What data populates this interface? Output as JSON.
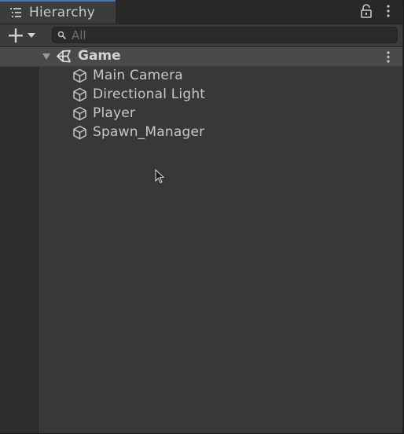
{
  "panel": {
    "title": "Hierarchy",
    "tab_icon": "list-icon",
    "lock_icon": "lock-icon",
    "menu_icon": "kebab-menu-icon"
  },
  "toolbar": {
    "add_icon": "plus-icon",
    "dropdown_icon": "dropdown-arrow-icon",
    "search": {
      "icon": "search-icon",
      "placeholder": "All",
      "value": ""
    }
  },
  "scene": {
    "name": "Game",
    "icon": "unity-scene-icon",
    "expanded": true
  },
  "objects": [
    {
      "label": "Main Camera",
      "icon": "gameobject-cube-icon"
    },
    {
      "label": "Directional Light",
      "icon": "gameobject-cube-icon"
    },
    {
      "label": "Player",
      "icon": "gameobject-cube-icon"
    },
    {
      "label": "Spawn_Manager",
      "icon": "gameobject-cube-icon"
    }
  ],
  "colors": {
    "accent": "#3a79bb",
    "panel_bg": "#383838",
    "scene_header_bg": "#4a4a4a",
    "text": "#c8c8c8"
  }
}
